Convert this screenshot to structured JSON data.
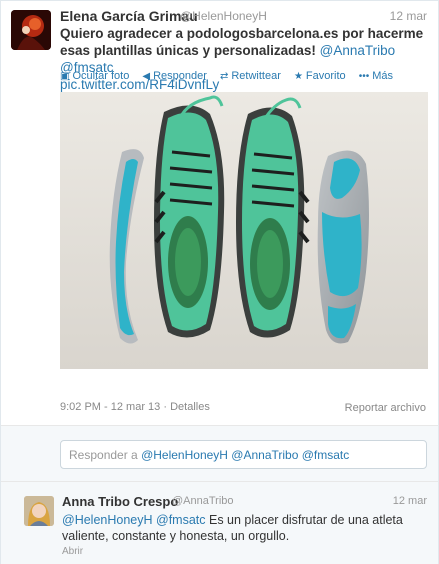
{
  "tweet": {
    "author_name": "Elena García Grimau",
    "author_handle": "@HelenHoneyH",
    "date": "12 mar",
    "text_main": "Quiero agradecer a podologosbarcelona.es por hacerme esas plantillas únicas y personalizadas!",
    "mention_1": "@AnnaTribo",
    "mention_2": "@fmsatc",
    "pic_link": "pic.twitter.com/RF4iDvnfLy",
    "actions": {
      "hide_photo": "Ocultar foto",
      "reply": "Responder",
      "retweet": "Retwittear",
      "favorite": "Favorito",
      "more": "Más"
    },
    "timestamp": "9:02 PM - 12 mar 13",
    "details": "Detalles",
    "report": "Reportar archivo"
  },
  "reply_box": {
    "prefix": "Responder a",
    "m1": "@HelenHoneyH",
    "m2": "@AnnaTribo",
    "m3": "@fmsatc"
  },
  "reply": {
    "author_name": "Anna Tribo Crespo",
    "author_handle": "@AnnaTribo",
    "date": "12 mar",
    "mention_1": "@HelenHoneyH",
    "mention_2": "@fmsatc",
    "text": "Es un placer  disfrutar de una atleta valiente, constante y honesta, un orgullo.",
    "open": "Abrir"
  },
  "colors": {
    "link": "#2a7ab0",
    "muted": "#999999",
    "shoe_green": "#4fc49a",
    "insole_teal": "#27b4cf"
  }
}
